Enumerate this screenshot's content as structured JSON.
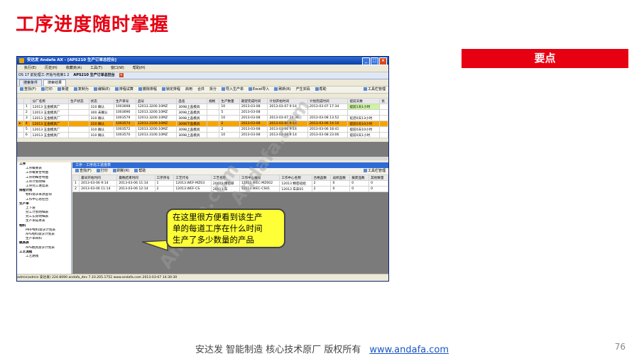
{
  "slide": {
    "title": "工序进度随时掌握",
    "key_points_label": "要点",
    "footer_text": "安达发   智能制造 核心技术原厂    版权所有",
    "footer_link": "www.andafa.com",
    "page_number": "76",
    "callout_lines": [
      "在这里很方便看到该生产",
      "单的每道工序在什么时间",
      "生产了多少数量的产品"
    ],
    "watermark": "Andafa.com",
    "accent_color": "#e60012",
    "callout_color": "#ffff38"
  },
  "app": {
    "window_title": "安达发 Andafa AX - [APS210 生产订单总控台]",
    "menu": [
      "执行(E)",
      "历史(H)",
      "收藏夹(A)",
      "工具(T)",
      "窗口(W)",
      "帮助(H)"
    ],
    "doc_tabs": [
      "OS 17 前处理工-开始与结束1 2",
      "APS210 生产订单总控台"
    ],
    "sub_tabs": [
      "搜索条件",
      "搜索结果"
    ],
    "toolbar": [
      "查找(F)",
      "打印",
      "新建",
      "复制为",
      "编辑(E)",
      "排程试算",
      "撤除排程",
      "锁定排程",
      "启用",
      "合并",
      "拆分",
      "导入生产单",
      "Excel导入",
      "刷新(R)",
      "产生实码",
      "帮助"
    ],
    "toolbar_right": "工具栏管理",
    "orders": {
      "columns": [
        "",
        "",
        "分厂名称",
        "生产状态",
        "状态",
        "生产单号",
        "品号",
        "品名",
        "规格",
        "生产数量",
        "期望完成时间",
        "计划开始时间",
        "计划完成时间",
        "提前天数",
        "优"
      ],
      "rows": [
        [
          "",
          "1",
          "12013 五金模具厂",
          "",
          "310 确认",
          "1003698",
          "12013.3200.10MZ",
          "3098上盖模具",
          "",
          "10",
          "2013-03-08",
          "2013-03-07 9:14",
          "2013-03-07 17:34",
          "提前1天1小时",
          ""
        ],
        [
          "",
          "2",
          "12013 五金模具厂",
          "",
          "300 未确认",
          "1003696",
          "12013.3200.10MZ",
          "3098上盖模具",
          "",
          "5",
          "2013-03-08",
          "",
          "",
          "",
          ""
        ],
        [
          "",
          "3",
          "12013 五金模具厂",
          "",
          "310 确认",
          "1003579",
          "12013.3200.10MZ",
          "3098上盖模具",
          "",
          "10",
          "2013-03-08",
          "2013-03-07 20:36",
          "2013-03-08 13:52",
          "延迟0天13小时",
          ""
        ],
        [
          "▸",
          "4",
          "12013 五金模具厂",
          "",
          "310 确认",
          "1003574",
          "12013.3100.10MZ",
          "3098下盖模具",
          "",
          "2",
          "2013-03-08",
          "2013-03-06 9:14",
          "2013-03-06 14:10",
          "提前0天10小时",
          ""
        ],
        [
          "",
          "5",
          "12013 五金模具厂",
          "",
          "310 确认",
          "1003572",
          "12013.3200.10MZ",
          "3098上盖模具",
          "",
          "2",
          "2013-03-08",
          "2013-03-06 9:14",
          "2013-03-06 18:41",
          "提前0天10小时",
          ""
        ],
        [
          "",
          "6",
          "12013 五金模具厂",
          "",
          "310 确认",
          "1003570",
          "12013.3100.10MZ",
          "3098上盖模具",
          "",
          "10",
          "2013-03-08",
          "2013-03-08 9:14",
          "2013-03-08 23:06",
          "提前0天1小时",
          ""
        ]
      ]
    },
    "tree": [
      "工序",
      "工序概要表",
      "工序概要甘特图",
      "工序明细甘特图",
      "工序计划明细",
      "工序完工进度表",
      "排程计划",
      "物料需求来源查询",
      "工作中心总控台",
      "生产单",
      "上下层",
      "完工计划明细表",
      "完工实际明细表",
      "生产单成本表",
      "物料",
      "MRP物料需求计划表",
      "APS物料需求计划表",
      "生产单目料",
      "模具表",
      "APS模具需求计划表",
      "工艺流程",
      "工艺路线"
    ],
    "detail": {
      "header": "工序 - 工序完工进度表",
      "toolbar": [
        "查找(F)",
        "打印",
        "刷新(R)",
        "帮助"
      ],
      "toolbar_right": "工具栏管理",
      "columns": [
        "",
        "最早开始时间",
        "最晚结束时间",
        "工序序号",
        "工艺代号",
        "工艺名称",
        "工作中心编号",
        "工作中心名称",
        "合格品数",
        "返修品数",
        "报废品数",
        "其他数量"
      ],
      "rows": [
        [
          "1",
          "2013-03-06 9:14",
          "2013-03-06 11:14",
          "1",
          "12013.WEF-MZ03",
          "20013 精密研",
          "12013.WEC-MZ002",
          "12013 精密班组",
          "2",
          "0",
          "0",
          "0"
        ],
        [
          "2",
          "2013-03-06 11:14",
          "2013-03-06 12:14",
          "2",
          "12013.WEF-CS",
          "20013 车",
          "12013.WEC-CS01",
          "12013 车床01",
          "2",
          "0",
          "0",
          "0"
        ]
      ]
    },
    "status": "admin(admin 安达发)   224.8090   andafa_dev   7.10.205.1752   www.andafa.com   2013-03-07 14:30:30"
  }
}
